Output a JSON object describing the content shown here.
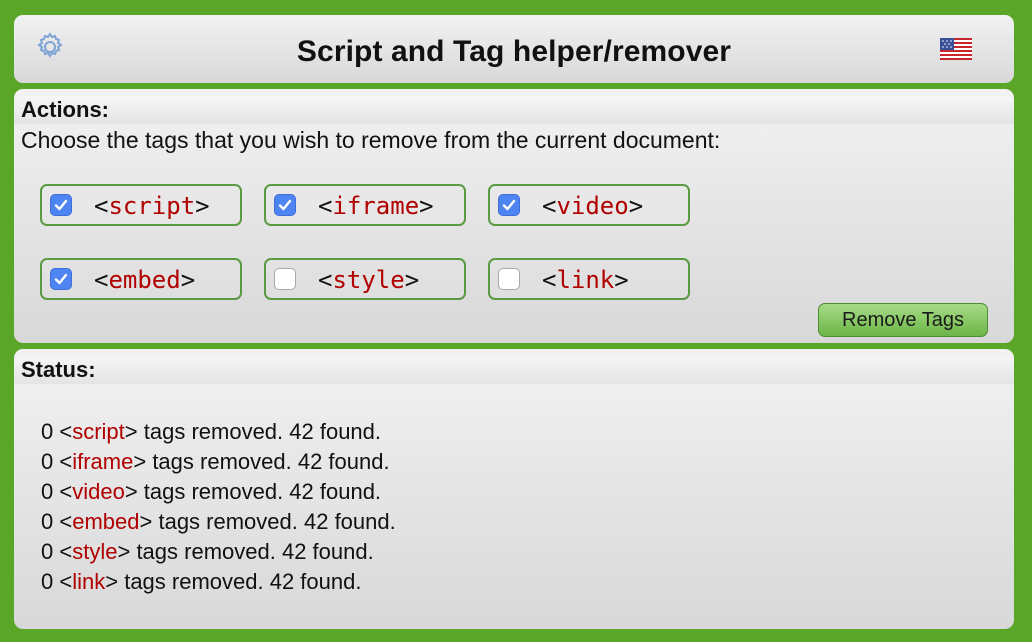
{
  "header": {
    "title": "Script and Tag helper/remover",
    "settings_icon": "gear-icon",
    "language_icon": "us-flag-icon"
  },
  "actions": {
    "heading": "Actions:",
    "instructions": "Choose the tags that you wish to remove from the current document:",
    "tags": [
      {
        "name": "script",
        "checked": true
      },
      {
        "name": "iframe",
        "checked": true
      },
      {
        "name": "video",
        "checked": true
      },
      {
        "name": "embed",
        "checked": true
      },
      {
        "name": "style",
        "checked": false
      },
      {
        "name": "link",
        "checked": false
      }
    ],
    "remove_button": "Remove Tags"
  },
  "status": {
    "heading": "Status:",
    "lines": [
      {
        "count": "0",
        "tag": "script",
        "text": " tags removed. 42 found."
      },
      {
        "count": "0",
        "tag": "iframe",
        "text": " tags removed. 42 found."
      },
      {
        "count": "0",
        "tag": "video",
        "text": " tags removed. 42 found."
      },
      {
        "count": "0",
        "tag": "embed",
        "text": " tags removed. 42 found."
      },
      {
        "count": "0",
        "tag": "style",
        "text": " tags removed. 42 found."
      },
      {
        "count": "0",
        "tag": "link",
        "text": " tags removed. 42 found."
      }
    ]
  },
  "colors": {
    "background": "#5aa628",
    "tag_name": "#b00000",
    "checkbox_checked": "#4f85f2",
    "button_green": "#8ccb6a"
  }
}
